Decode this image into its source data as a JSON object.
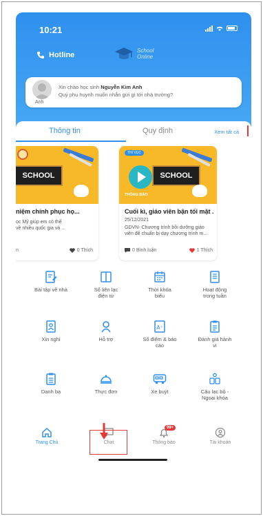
{
  "status": {
    "time": "10:21"
  },
  "header": {
    "hotline_label": "Hotline",
    "logo_text_line1": "School",
    "logo_text_line2": "Online"
  },
  "greeting": {
    "avatar_label": "Anh",
    "prefix": "Xin chào học sinh ",
    "student_name": "Nguyễn Kim Anh",
    "line2": "Quý phụ huynh muốn nhắn gửi gì tới nhà trường?"
  },
  "tabs": {
    "info": "Thông tin",
    "rules": "Quy định",
    "see_all": "Xem tất cả"
  },
  "news": [
    {
      "title": "niệm chính phục họ...",
      "desc_line1": "ọc Mỹ giúp em có thể",
      "desc_line2": "về nhiều quốc gia và ...",
      "left_footer": "n",
      "likes": "0 Thích",
      "chalk": "SCHOOL"
    },
    {
      "tag": "THI VỤC",
      "thumb_caption": "THÔNG BÁO",
      "title": "Cuối kì, giáo viên bận tối mặt ...",
      "date": "25/12/2021",
      "desc_line1": "GDVN- Chương trình bồi dưỡng giáo",
      "desc_line2": "viên để chuẩn bị dạy chương trình m...",
      "comments": "0 Bình luận",
      "likes": "1 Thích",
      "chalk": "SCHOOL"
    }
  ],
  "features": [
    {
      "label1": "Bài tập về nhà",
      "label2": "",
      "icon": "homework-icon"
    },
    {
      "label1": "Sổ liên lạc",
      "label2": "điện tử",
      "icon": "contact-book-icon"
    },
    {
      "label1": "Thời khóa",
      "label2": "biểu",
      "icon": "timetable-icon"
    },
    {
      "label1": "Hoạt động",
      "label2": "trong tuần",
      "icon": "weekly-activity-icon"
    },
    {
      "label1": "Xin nghỉ",
      "label2": "",
      "icon": "leave-request-icon"
    },
    {
      "label1": "Hỗ trợ",
      "label2": "",
      "icon": "support-icon"
    },
    {
      "label1": "Sổ điểm & báo",
      "label2": "cáo",
      "icon": "gradebook-icon"
    },
    {
      "label1": "Đánh giá hành",
      "label2": "vi",
      "icon": "behavior-icon"
    },
    {
      "label1": "Danh bạ",
      "label2": "",
      "icon": "directory-icon"
    },
    {
      "label1": "Thực đơn",
      "label2": "",
      "icon": "menu-food-icon"
    },
    {
      "label1": "Xe buýt",
      "label2": "",
      "icon": "bus-icon"
    },
    {
      "label1": "Câu lạc bộ -",
      "label2": "Ngoại khóa",
      "icon": "club-icon"
    }
  ],
  "nav": {
    "home": "Trang Chủ",
    "chat": "Chat",
    "notifications": "Thông báo",
    "account": "Tài khoản",
    "notif_badge": "99+"
  },
  "colors": {
    "primary": "#2f8fee",
    "accent_red": "#e53935",
    "thumb_yellow": "#f7b928"
  }
}
